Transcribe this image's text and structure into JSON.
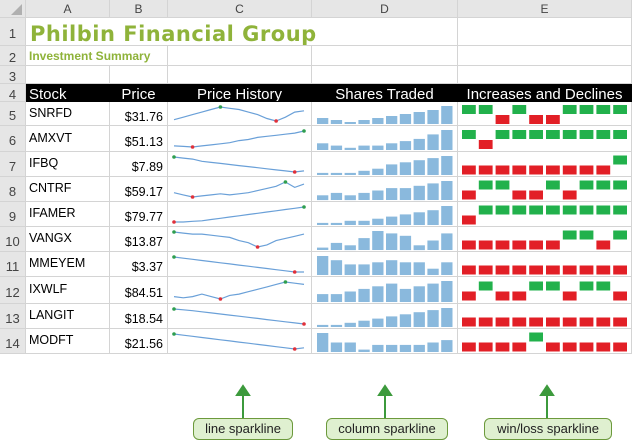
{
  "columns": [
    "A",
    "B",
    "C",
    "D",
    "E"
  ],
  "row_numbers": [
    "1",
    "2",
    "3",
    "4",
    "5",
    "6",
    "7",
    "8",
    "9",
    "10",
    "11",
    "12",
    "13",
    "14"
  ],
  "title": "Philbin Financial Group",
  "subtitle": "Investment Summary",
  "headers": {
    "stock": "Stock",
    "price": "Price",
    "price_history": "Price History",
    "shares_traded": "Shares Traded",
    "increases_declines": "Increases and Declines"
  },
  "rows": [
    {
      "stock": "SNRFD",
      "price": "$31.76",
      "history": [
        4,
        5,
        6,
        7,
        8,
        9,
        8.5,
        8,
        7,
        6,
        4.5,
        3.5,
        5,
        7,
        7.5
      ],
      "shares": [
        3,
        2,
        1,
        2,
        3,
        4,
        5,
        6,
        7,
        9
      ],
      "winloss": [
        1,
        1,
        -1,
        1,
        -1,
        -1,
        1,
        1,
        1,
        1
      ]
    },
    {
      "stock": "AMXVT",
      "price": "$51.13",
      "history": [
        2,
        1.8,
        1.5,
        2,
        2.5,
        3,
        3.5,
        4.5,
        5,
        6,
        6.5,
        7,
        7.5,
        8,
        9
      ],
      "shares": [
        3,
        2,
        1,
        2,
        2,
        3,
        4,
        5,
        7,
        9
      ],
      "winloss": [
        1,
        -1,
        1,
        1,
        1,
        1,
        1,
        1,
        1,
        1
      ]
    },
    {
      "stock": "IFBQ",
      "price": "$7.89",
      "history": [
        9,
        8.5,
        8,
        7,
        6.5,
        6,
        5.5,
        5,
        4.5,
        4,
        3.5,
        3,
        2.5,
        2,
        2.5
      ],
      "shares": [
        1,
        1,
        1,
        2,
        3,
        5,
        6,
        7,
        8,
        9
      ],
      "winloss": [
        -1,
        -1,
        -1,
        -1,
        -1,
        -1,
        -1,
        -1,
        -1,
        1
      ]
    },
    {
      "stock": "CNTRF",
      "price": "$59.17",
      "history": [
        4,
        3,
        2,
        2.5,
        3,
        3.5,
        3,
        3.5,
        4,
        5,
        6,
        7,
        9,
        6.5,
        8
      ],
      "shares": [
        2,
        3,
        2,
        3,
        4,
        5,
        5,
        6,
        7,
        8
      ],
      "winloss": [
        -1,
        1,
        1,
        -1,
        -1,
        1,
        -1,
        1,
        1,
        1
      ]
    },
    {
      "stock": "IFAMER",
      "price": "$79.77",
      "history": [
        2,
        2,
        2.3,
        2.5,
        3,
        3.5,
        4,
        4.5,
        5,
        5.5,
        6,
        6.5,
        7,
        7.5,
        8
      ],
      "shares": [
        1,
        1,
        2,
        2,
        3,
        4,
        5,
        6,
        7,
        9
      ],
      "winloss": [
        -1,
        1,
        1,
        1,
        1,
        1,
        1,
        1,
        1,
        1
      ]
    },
    {
      "stock": "VANGX",
      "price": "$13.87",
      "history": [
        9,
        8.5,
        8,
        8,
        7.5,
        7,
        6.5,
        5,
        4,
        2,
        3,
        5,
        6,
        7,
        8
      ],
      "shares": [
        1,
        3,
        2,
        5,
        8,
        7,
        6,
        2,
        4,
        7
      ],
      "winloss": [
        -1,
        -1,
        -1,
        -1,
        -1,
        -1,
        1,
        1,
        -1,
        1
      ]
    },
    {
      "stock": "MMEYEM",
      "price": "$3.37",
      "history": [
        9,
        8.5,
        8,
        7.5,
        7,
        6.5,
        6,
        5.5,
        5,
        4.5,
        4,
        3.5,
        3,
        2.5,
        2.5
      ],
      "shares": [
        9,
        7,
        5,
        5,
        6,
        7,
        6,
        6,
        3,
        6
      ],
      "winloss": [
        -1,
        -1,
        -1,
        -1,
        -1,
        -1,
        -1,
        -1,
        -1,
        -1
      ]
    },
    {
      "stock": "IXWLF",
      "price": "$84.51",
      "history": [
        3,
        2.5,
        3,
        4,
        3,
        2,
        3.5,
        4,
        5,
        6,
        7,
        8,
        9,
        8.5,
        8
      ],
      "shares": [
        3,
        3,
        4,
        5,
        6,
        7,
        5,
        6,
        7,
        8
      ],
      "winloss": [
        -1,
        1,
        -1,
        -1,
        1,
        1,
        -1,
        1,
        1,
        -1
      ]
    },
    {
      "stock": "LANGIT",
      "price": "$18.54",
      "history": [
        9,
        8.7,
        8.4,
        8,
        7.6,
        7.2,
        6.8,
        6.4,
        6,
        5.6,
        5.2,
        4.8,
        4.4,
        4,
        3.6
      ],
      "shares": [
        1,
        1,
        2,
        3,
        4,
        5,
        6,
        7,
        8,
        9
      ],
      "winloss": [
        -1,
        -1,
        -1,
        -1,
        -1,
        -1,
        -1,
        -1,
        -1,
        -1
      ]
    },
    {
      "stock": "MODFT",
      "price": "$21.56",
      "history": [
        9,
        8.5,
        8,
        7.5,
        7,
        6.5,
        6,
        5.5,
        5,
        4.5,
        4,
        3.5,
        3,
        2.5,
        3
      ],
      "shares": [
        8,
        4,
        4,
        1,
        3,
        3,
        3,
        3,
        4,
        5
      ],
      "winloss": [
        -1,
        -1,
        -1,
        -1,
        1,
        -1,
        -1,
        -1,
        -1,
        -1
      ]
    }
  ],
  "callouts": {
    "line": "line sparkline",
    "column": "column sparkline",
    "winloss": "win/loss sparkline"
  },
  "colors": {
    "title": "#8fb33a",
    "line": "#6aa0d8",
    "column": "#8ab9dd",
    "win": "#22b14c",
    "loss": "#e21f26",
    "marker_high": "#2e9e4f",
    "marker_low": "#e0303a",
    "callout_arrow": "#3c9a3c"
  }
}
